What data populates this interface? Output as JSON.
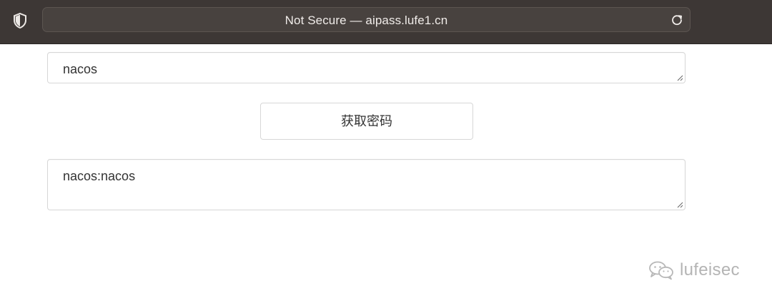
{
  "browser": {
    "url_text": "Not Secure — aipass.lufe1.cn"
  },
  "form": {
    "input_value": "nacos",
    "button_label": "获取密码",
    "output_value": "nacos:nacos"
  },
  "watermark": {
    "text": "lufeisec"
  }
}
